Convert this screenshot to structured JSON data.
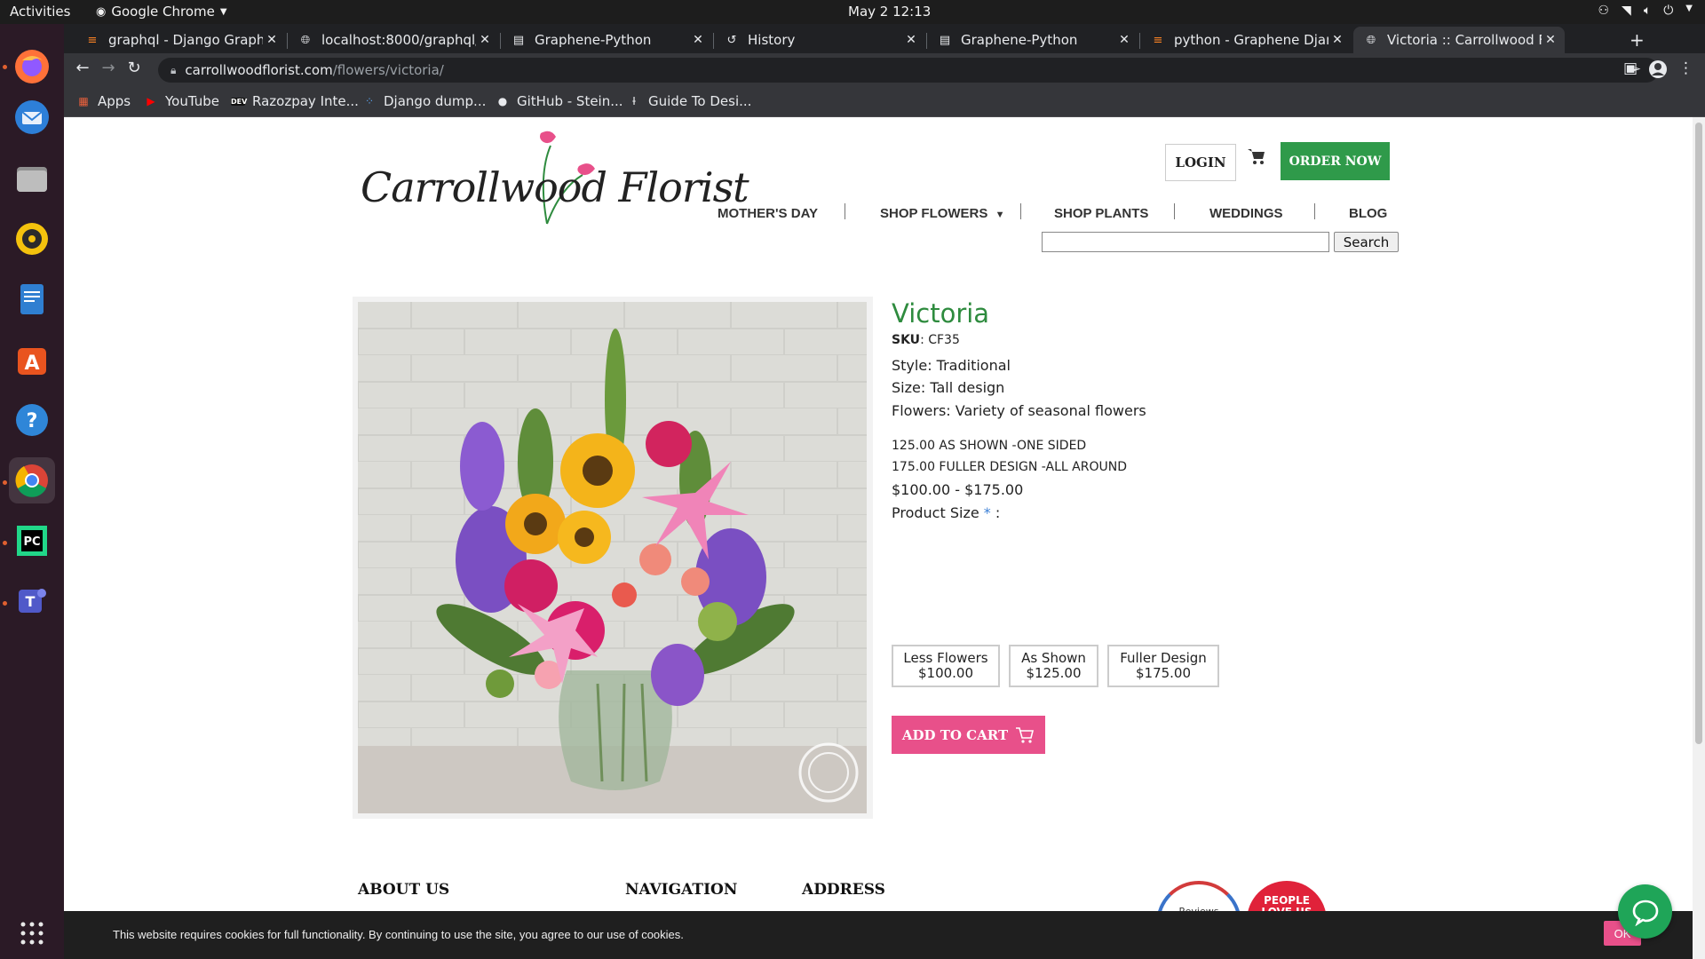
{
  "os": {
    "activities": "Activities",
    "app_name": "Google Chrome",
    "clock": "May 2  12:13"
  },
  "dock": {
    "items": [
      "firefox-icon",
      "thunderbird-icon",
      "files-icon",
      "rhythmbox-icon",
      "writer-icon",
      "software-icon",
      "help-icon",
      "chrome-icon",
      "pycharm-icon",
      "teams-icon",
      "show-apps-icon"
    ]
  },
  "tabs": [
    {
      "title": "graphql - Django Graphene",
      "icon": "stackoverflow-icon"
    },
    {
      "title": "localhost:8000/graphql/",
      "icon": "globe-icon"
    },
    {
      "title": "Graphene-Python",
      "icon": "doc-icon"
    },
    {
      "title": "History",
      "icon": "history-icon"
    },
    {
      "title": "Graphene-Python",
      "icon": "doc-icon"
    },
    {
      "title": "python - Graphene Django",
      "icon": "stackoverflow-icon"
    },
    {
      "title": "Victoria :: Carrollwood Florist",
      "icon": "globe-icon"
    }
  ],
  "address": {
    "domain": "carrollwoodflorist.com",
    "path": "/flowers/victoria/"
  },
  "bookmarks": [
    {
      "label": "Apps",
      "icon": "apps-grid-icon"
    },
    {
      "label": "YouTube",
      "icon": "youtube-icon"
    },
    {
      "label": "Razozpay Inte...",
      "icon": "dev-icon"
    },
    {
      "label": "Django dump...",
      "icon": "dots-icon"
    },
    {
      "label": "GitHub - Stein...",
      "icon": "github-icon"
    },
    {
      "label": "Guide To Desi...",
      "icon": "bookmark-icon"
    }
  ],
  "site": {
    "logo_text": "Carrollwood Florist",
    "login": "LOGIN",
    "order_now": "ORDER NOW",
    "nav": [
      "MOTHER'S DAY",
      "SHOP FLOWERS",
      "SHOP PLANTS",
      "WEDDINGS",
      "BLOG"
    ],
    "search_button": "Search",
    "search_value": ""
  },
  "product": {
    "title": "Victoria",
    "sku_label": "SKU",
    "sku": ": CF35",
    "style": "Style: Traditional",
    "size": "Size: Tall design",
    "flowers": "Flowers: Variety of seasonal flowers",
    "price_note_1": "125.00 AS SHOWN -ONE SIDED",
    "price_note_2": "175.00 FULLER DESIGN -ALL AROUND",
    "price_range": "$100.00 - $175.00",
    "size_label": "Product Size",
    "size_required": "*",
    "size_colon": ":",
    "options": [
      {
        "name": "Less Flowers",
        "price": "$100.00"
      },
      {
        "name": "As Shown",
        "price": "$125.00"
      },
      {
        "name": "Fuller Design",
        "price": "$175.00"
      }
    ],
    "add_to_cart": "ADD TO CART"
  },
  "footer": {
    "about": "ABOUT US",
    "navigation": "NAVIGATION",
    "address": "ADDRESS",
    "badge_a": "Reviews",
    "badge_b": "PEOPLE LOVE US"
  },
  "cookie": {
    "text": "This website requires cookies for full functionality. By continuing to use the site, you agree to our use of cookies.",
    "ok": "OK"
  },
  "colors": {
    "brand_green": "#2f9a4a",
    "title_green": "#2e8b3e",
    "cart_pink": "#e8508a",
    "chat_green": "#1fa558"
  }
}
